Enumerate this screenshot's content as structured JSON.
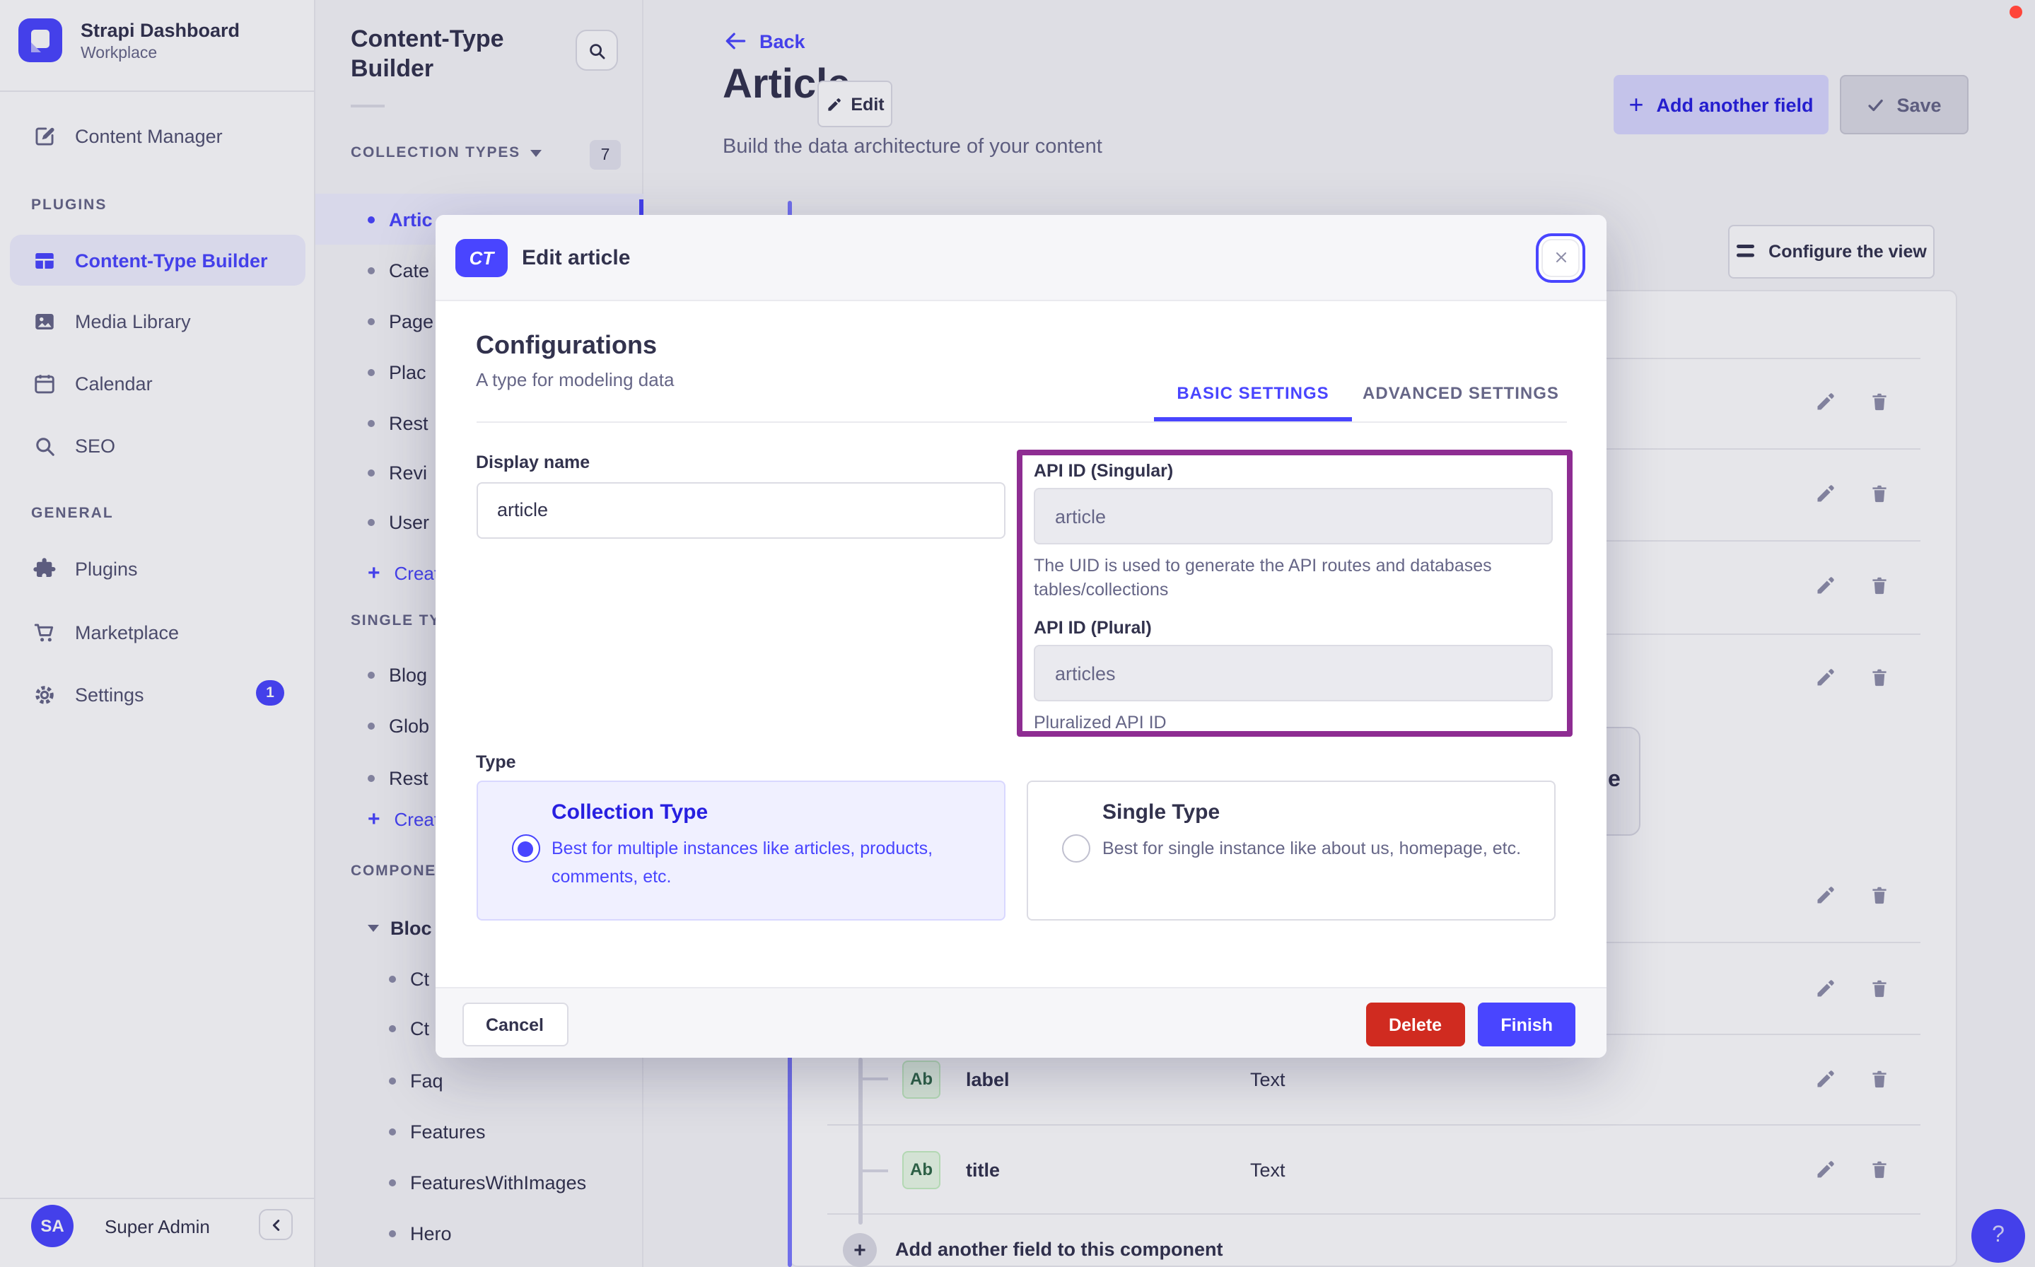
{
  "colors": {
    "primary": "#4945ff",
    "primary_dark": "#271fe0",
    "primary_bg": "#f0f0ff",
    "danger": "#d02b20",
    "annotation": "#8e2d92",
    "green_bg": "#eafbe7",
    "green_bd": "#c6f0c2",
    "green_tx": "#2f6846"
  },
  "icons": {
    "plus": "+",
    "question": "?",
    "ellipsis_e": "e"
  },
  "sidebar": {
    "brand": {
      "title": "Strapi Dashboard",
      "subtitle": "Workplace"
    },
    "content_manager": "Content Manager",
    "sections": [
      {
        "label": "PLUGINS",
        "items": [
          {
            "label": "Content-Type Builder",
            "active": true
          },
          {
            "label": "Media Library"
          },
          {
            "label": "Calendar"
          },
          {
            "label": "SEO"
          }
        ]
      },
      {
        "label": "GENERAL",
        "items": [
          {
            "label": "Plugins"
          },
          {
            "label": "Marketplace"
          },
          {
            "label": "Settings",
            "badge": "1"
          }
        ]
      }
    ],
    "user": {
      "initials": "SA",
      "name": "Super Admin"
    }
  },
  "panel": {
    "title": "Content-Type Builder",
    "collection_types": {
      "label": "COLLECTION TYPES",
      "count": "7",
      "items": [
        "Artic",
        "Cate",
        "Page",
        "Plac",
        "Rest",
        "Revi",
        "User"
      ],
      "create_label": "Create"
    },
    "single_types": {
      "label": "SINGLE TY",
      "items": [
        "Blog",
        "Glob",
        "Rest"
      ],
      "create_label": "Create"
    },
    "components": {
      "label": "COMPONE",
      "group": "Bloc",
      "items": [
        "Ct",
        "Ct",
        "Faq",
        "Features",
        "FeaturesWithImages",
        "Hero"
      ]
    }
  },
  "header": {
    "back": "Back",
    "title": "Article",
    "edit": "Edit",
    "subtitle": "Build the data architecture of your content",
    "add_field": "Add another field",
    "save": "Save",
    "configure": "Configure the view"
  },
  "content": {
    "partial_text": "e",
    "fields": [
      {
        "badge": "Ab",
        "name": "label",
        "type": "Text"
      },
      {
        "badge": "Ab",
        "name": "title",
        "type": "Text"
      }
    ],
    "add_row": "Add another field to this component"
  },
  "modal": {
    "badge": "CT",
    "title": "Edit article",
    "heading": "Configurations",
    "subheading": "A type for modeling data",
    "tabs": [
      "BASIC SETTINGS",
      "ADVANCED SETTINGS"
    ],
    "display_name": {
      "label": "Display name",
      "value": "article"
    },
    "api_singular": {
      "label": "API ID (Singular)",
      "value": "article",
      "help": "The UID is used to generate the API routes and databases tables/collections"
    },
    "api_plural": {
      "label": "API ID (Plural)",
      "value": "articles",
      "help": "Pluralized API ID"
    },
    "type": {
      "label": "Type",
      "options": [
        {
          "title": "Collection Type",
          "desc": "Best for multiple instances like articles, products, comments, etc.",
          "selected": true
        },
        {
          "title": "Single Type",
          "desc": "Best for single instance like about us, homepage, etc.",
          "selected": false
        }
      ]
    },
    "footer": {
      "cancel": "Cancel",
      "delete": "Delete",
      "finish": "Finish"
    }
  }
}
